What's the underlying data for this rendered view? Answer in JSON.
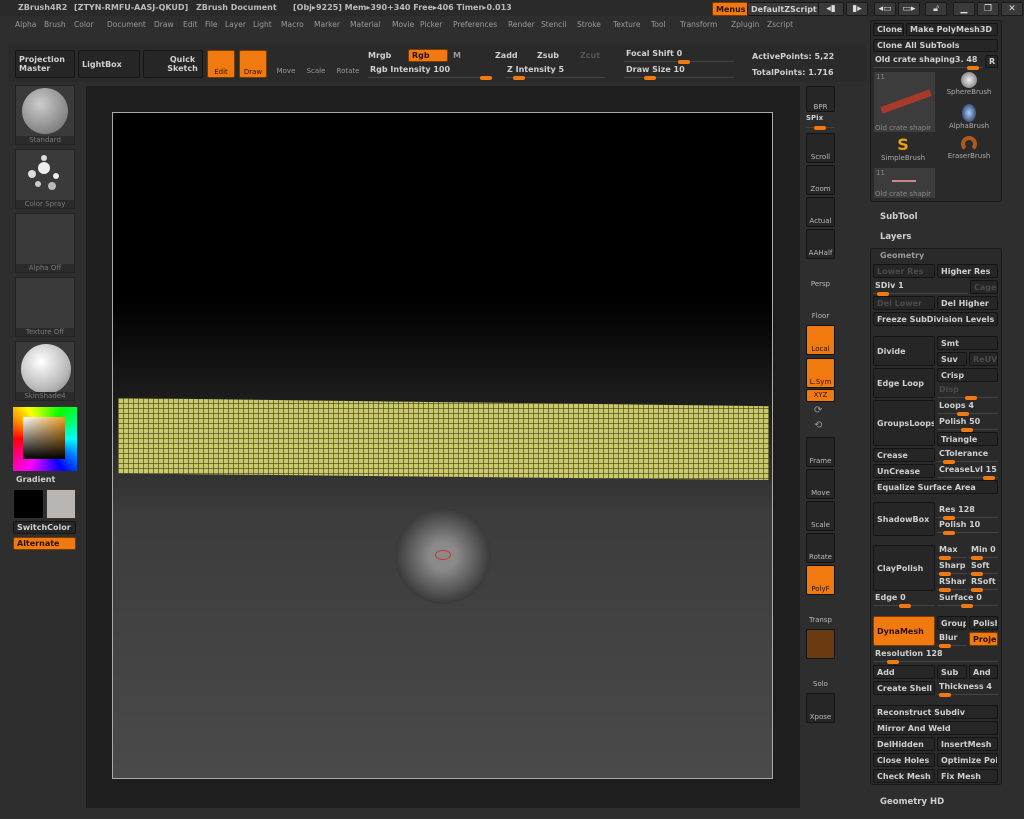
{
  "title": {
    "app": "ZBrush4R2",
    "serial": "[ZTYN-RMFU-AASJ-QKUD]",
    "doc": "ZBrush Document",
    "stats": "[Obj▸9225] Mem▸390+340 Free▸406 Timer▸0.013"
  },
  "topright": {
    "menus": "Menus",
    "script": "DefaultZScript"
  },
  "menus": [
    "Alpha",
    "Brush",
    "Color",
    "Document",
    "Draw",
    "Edit",
    "File",
    "Layer",
    "Light",
    "Macro",
    "Marker",
    "Material",
    "Movie",
    "Picker",
    "Preferences",
    "Render",
    "Stencil",
    "Stroke",
    "Texture",
    "Tool",
    "Transform",
    "Zplugin",
    "Zscript"
  ],
  "toolbar": {
    "projection": "Projection Master",
    "lightbox": "LightBox",
    "quicksketch": "Quick Sketch",
    "edit": "Edit",
    "draw": "Draw",
    "move": "Move",
    "scale": "Scale",
    "rotate": "Rotate",
    "mrgb": "Mrgb",
    "rgb": "Rgb",
    "m": "M",
    "zadd": "Zadd",
    "zsub": "Zsub",
    "zcut": "Zcut",
    "rgb_intensity": "Rgb Intensity 100",
    "z_intensity": "Z Intensity 5",
    "focal_shift": "Focal Shift 0",
    "draw_size": "Draw Size 10",
    "active_points": "ActivePoints: 5,22",
    "total_points": "TotalPoints: 1.716"
  },
  "left": {
    "brush": "Standard",
    "stroke": "Color Spray",
    "alpha": "Alpha Off",
    "texture": "Texture Off",
    "material": "SkinShade4",
    "gradient": "Gradient",
    "switchcolor": "SwitchColor",
    "alternate": "Alternate"
  },
  "shelf": {
    "bpr": "BPR",
    "spix": "SPix",
    "scroll": "Scroll",
    "zoom": "Zoom",
    "actual": "Actual",
    "aahalf": "AAHalf",
    "persp": "Persp",
    "floor": "Floor",
    "local": "Local",
    "lsym": "L.Sym",
    "xyz": "XYZ",
    "frame": "Frame",
    "move": "Move",
    "scale": "Scale",
    "rotate": "Rotate",
    "polyf": "PolyF",
    "transp": "Transp",
    "solo": "Solo",
    "xpose": "Xpose"
  },
  "tool": {
    "clone": "Clone",
    "make_polymesh": "Make PolyMesh3D",
    "clone_all": "Clone All SubTools",
    "current": "Old crate shaping3. 48",
    "r": "R",
    "count": "11",
    "item1": "Old crate shapir",
    "sphere": "SphereBrush",
    "alpha": "AlphaBrush",
    "simple": "SimpleBrush",
    "eraser": "EraserBrush",
    "item2": "Old crate shapir"
  },
  "sections": {
    "subtool": "SubTool",
    "layers": "Layers",
    "geometry": "Geometry",
    "geometry_hd": "Geometry HD"
  },
  "geometry": {
    "lower_res": "Lower Res",
    "higher_res": "Higher Res",
    "sdiv": "SDiv 1",
    "cage": "Cage",
    "del_lower": "Del Lower",
    "del_higher": "Del Higher",
    "freeze": "Freeze SubDivision Levels",
    "divide": "Divide",
    "smt": "Smt",
    "suv": "Suv",
    "reuv": "ReUV",
    "edge_loop": "Edge Loop",
    "crisp": "Crisp",
    "disp": "Disp",
    "groupsloops": "GroupsLoops",
    "loops": "Loops 4",
    "polish50": "Polish 50",
    "triangle": "Triangle",
    "crease": "Crease",
    "ctolerance": "CTolerance",
    "uncrease": "UnCrease",
    "creaselvl": "CreaseLvl 15",
    "equalize": "Equalize Surface Area",
    "shadowbox": "ShadowBox",
    "res128": "Res 128",
    "polish10": "Polish 10",
    "claypolish": "ClayPolish",
    "max": "Max",
    "min": "Min 0",
    "sharp": "Sharp",
    "soft": "Soft",
    "rshar": "RShar",
    "rsoft": "RSoft",
    "edge": "Edge 0",
    "surface": "Surface 0",
    "dynamesh": "DynaMesh",
    "group": "Group",
    "polish": "Polish",
    "blur": "Blur",
    "project": "Projec",
    "resolution": "Resolution 128",
    "add": "Add",
    "sub": "Sub",
    "and": "And",
    "create_shell": "Create Shell",
    "thickness": "Thickness 4",
    "reconstruct": "Reconstruct Subdiv",
    "mirror": "Mirror And Weld",
    "delhidden": "DelHidden",
    "insertmesh": "InsertMesh",
    "close_holes": "Close Holes",
    "optimize": "Optimize Poi",
    "check_mesh": "Check Mesh",
    "fix_mesh": "Fix Mesh"
  },
  "colors": {
    "accent": "#f07a10",
    "mesh": "#c9c86a"
  }
}
